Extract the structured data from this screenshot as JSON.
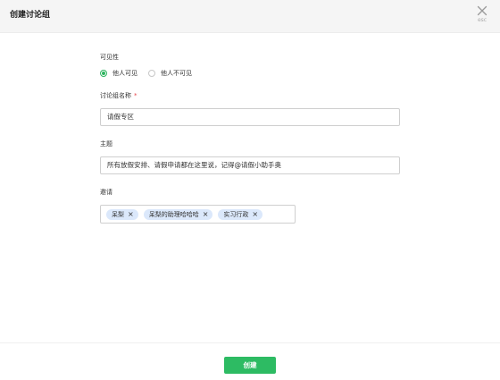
{
  "dialog": {
    "title": "创建讨论组",
    "close_hint": "esc"
  },
  "visibility": {
    "label": "可见性",
    "options": [
      {
        "label": "他人可见",
        "checked": true
      },
      {
        "label": "他人不可见",
        "checked": false
      }
    ]
  },
  "group_name": {
    "label": "讨论组名称",
    "required_mark": "*",
    "value": "请假专区"
  },
  "topic": {
    "label": "主题",
    "value": "所有放假安排、请假申请都在这里说，记得@请假小助手奥"
  },
  "invite": {
    "label": "邀请",
    "tags": [
      "呆梨",
      "呆梨的助理哈哈哈",
      "实习行政"
    ]
  },
  "footer": {
    "create_label": "创建"
  },
  "colors": {
    "accent": "#2dbb63",
    "tag_bg": "#dbe8fb",
    "required": "#e8464a"
  },
  "icons": {
    "close": "close-icon",
    "tag_remove": "tag-remove-icon"
  }
}
